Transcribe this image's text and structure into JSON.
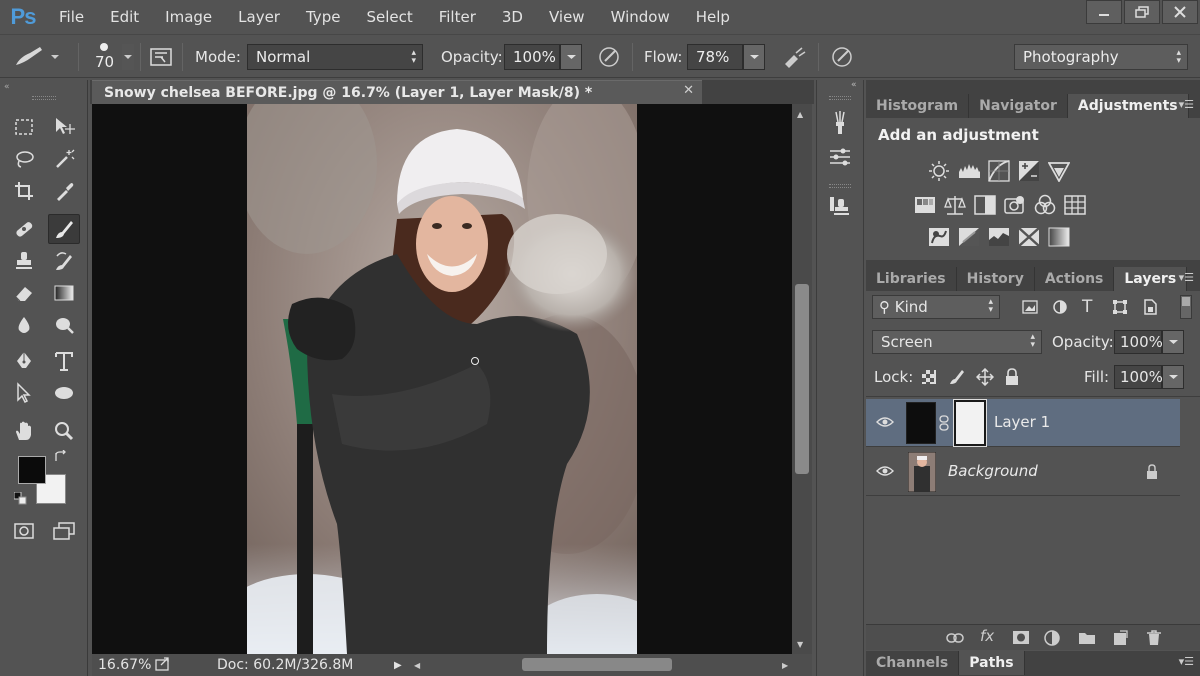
{
  "app": {
    "logo": "Ps"
  },
  "menu": [
    "File",
    "Edit",
    "Image",
    "Layer",
    "Type",
    "Select",
    "Filter",
    "3D",
    "View",
    "Window",
    "Help"
  ],
  "options": {
    "brush_size": "70",
    "mode_label": "Mode:",
    "mode_value": "Normal",
    "opacity_label": "Opacity:",
    "opacity_value": "100%",
    "flow_label": "Flow:",
    "flow_value": "78%",
    "workspace": "Photography"
  },
  "document": {
    "tab_title": "Snowy chelsea BEFORE.jpg @ 16.7% (Layer 1, Layer Mask/8) *",
    "zoom": "16.67%",
    "doc_size": "Doc: 60.2M/326.8M"
  },
  "adjustments_panel": {
    "tabs": [
      "Histogram",
      "Navigator",
      "Adjustments"
    ],
    "active_tab": "Adjustments",
    "heading": "Add an adjustment",
    "icons": [
      "brightness-icon",
      "levels-icon",
      "curves-icon",
      "exposure-icon",
      "vibrance-icon",
      "hue-saturation-icon",
      "color-balance-icon",
      "black-white-icon",
      "photo-filter-icon",
      "channel-mixer-icon",
      "color-lookup-icon",
      "invert-icon",
      "posterize-icon",
      "threshold-icon",
      "selective-color-icon",
      "gradient-map-icon"
    ]
  },
  "layers_panel": {
    "tabs": [
      "Libraries",
      "History",
      "Actions",
      "Layers"
    ],
    "active_tab": "Layers",
    "filter_kind": "Kind",
    "blend_mode": "Screen",
    "opacity_label": "Opacity:",
    "opacity_value": "100%",
    "lock_label": "Lock:",
    "fill_label": "Fill:",
    "fill_value": "100%",
    "layers": [
      {
        "name": "Layer 1",
        "selected": true
      },
      {
        "name": "Background",
        "selected": false,
        "locked": true
      }
    ]
  },
  "bottom_panel": {
    "tabs": [
      "Channels",
      "Paths"
    ],
    "active_tab": "Paths"
  },
  "colors": {
    "accent_blue": "#4f9bd9",
    "selected_layer": "#5f6d80",
    "ui_bg": "#535353"
  }
}
